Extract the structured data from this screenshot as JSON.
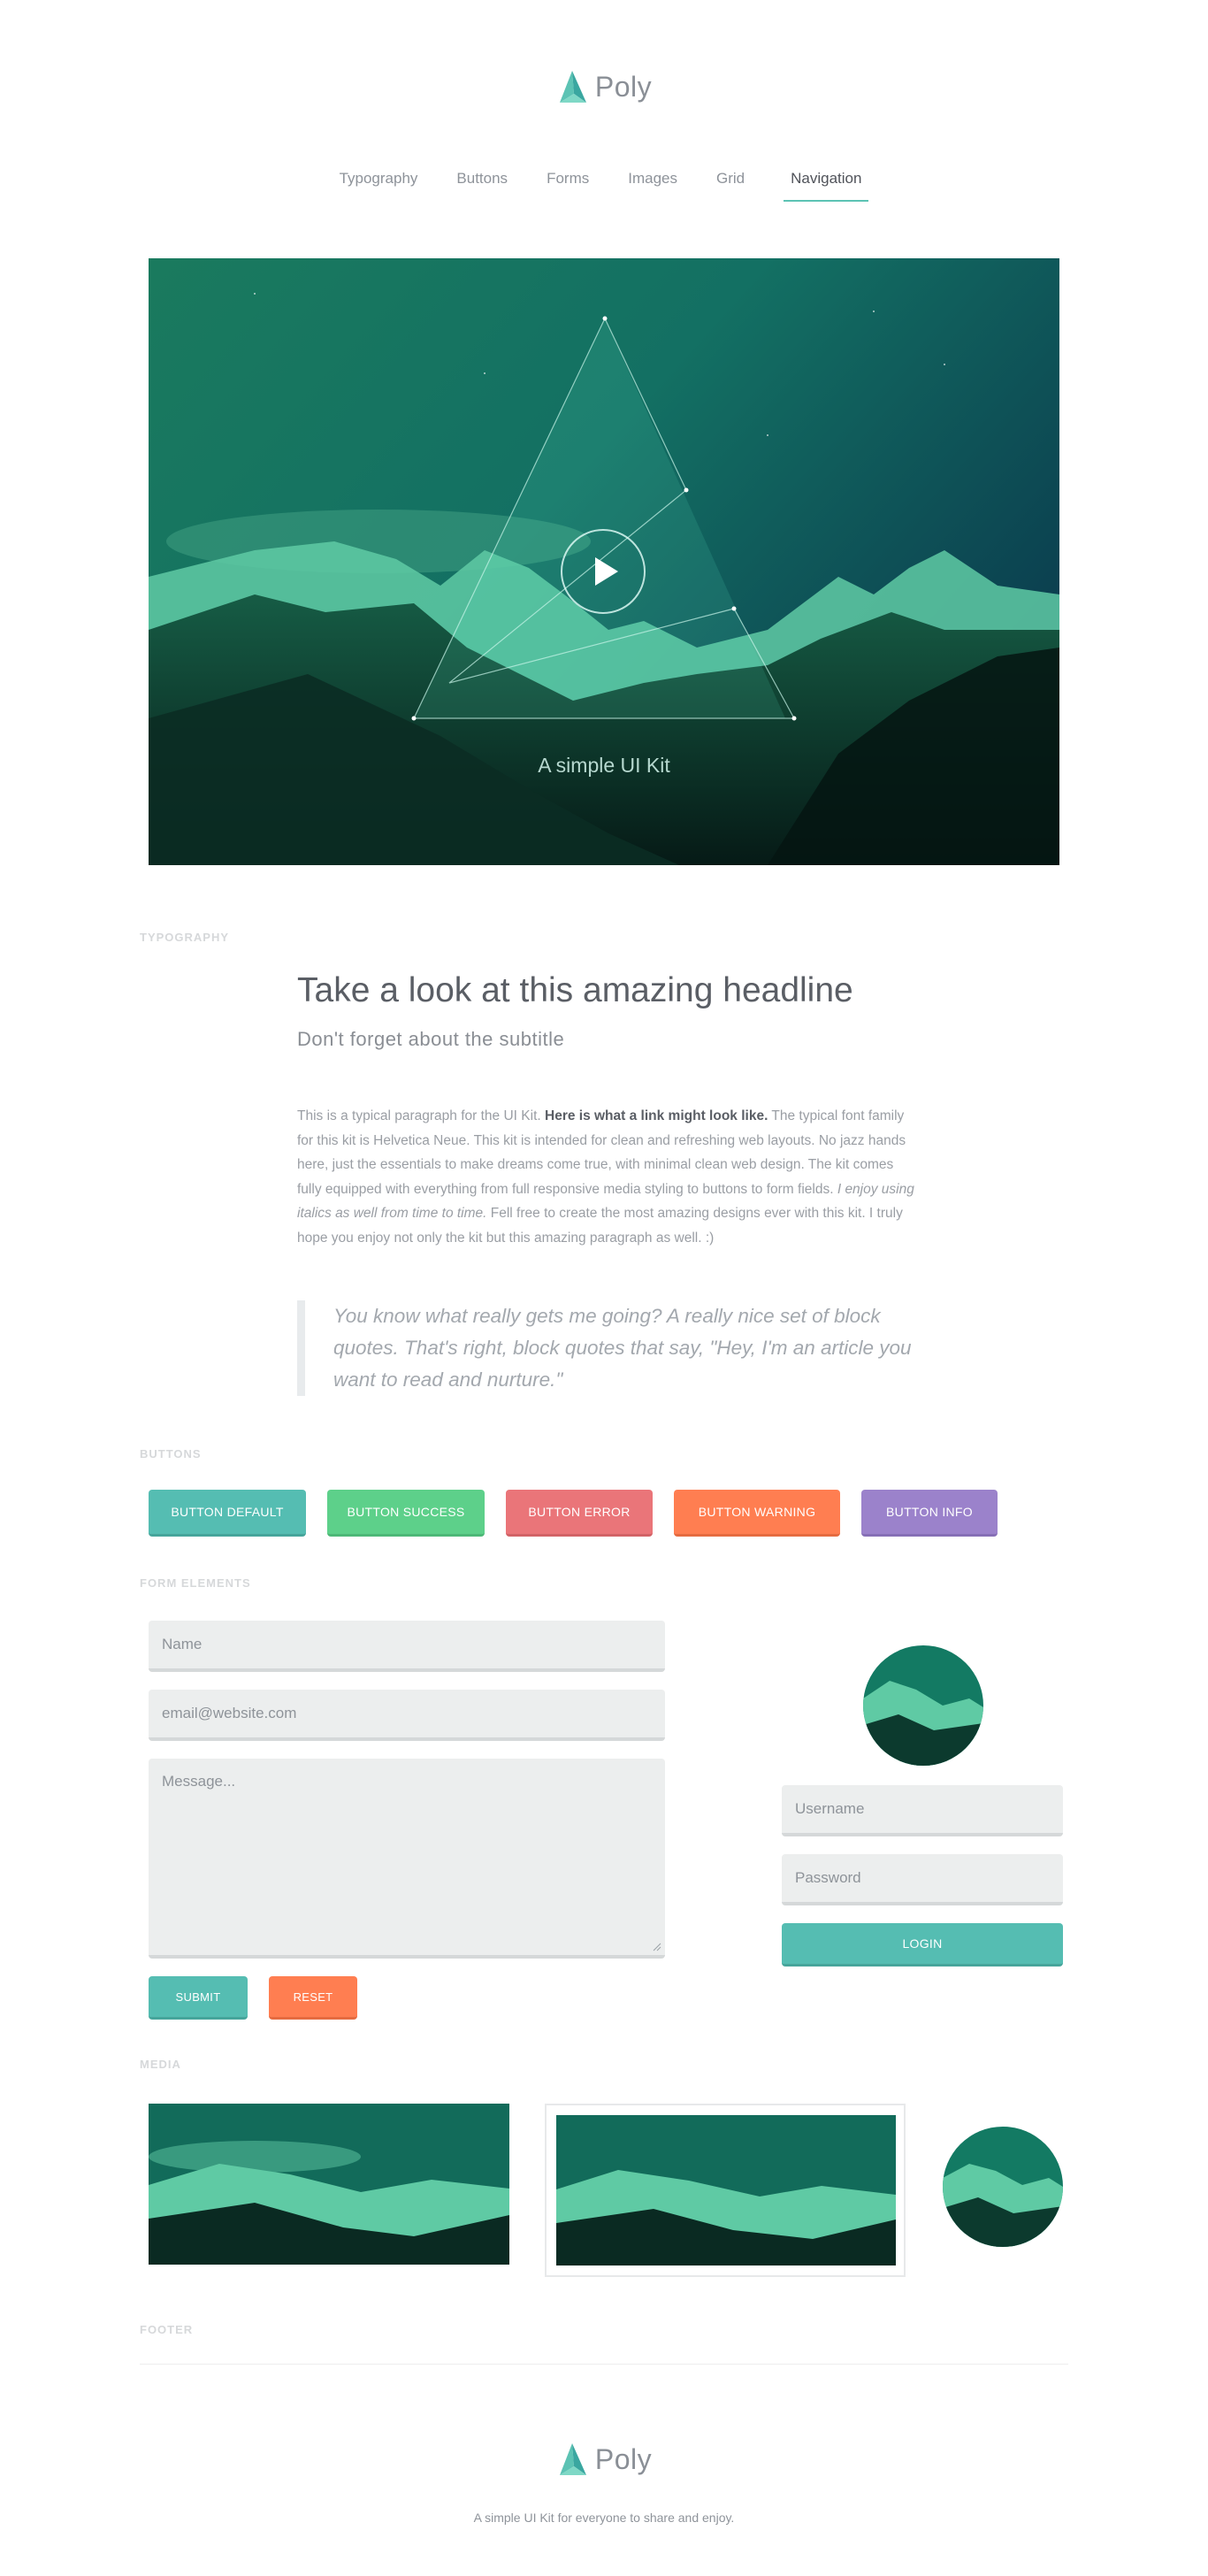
{
  "brand": {
    "name": "Poly",
    "accent": "#5cc3b4"
  },
  "nav": {
    "items": [
      "Typography",
      "Buttons",
      "Forms",
      "Images",
      "Grid",
      "Navigation"
    ],
    "active": "Navigation"
  },
  "hero": {
    "caption": "A simple UI Kit",
    "play_icon": "play-icon"
  },
  "sections": {
    "typography": "TYPOGRAPHY",
    "buttons": "BUTTONS",
    "forms": "FORM ELEMENTS",
    "media": "MEDIA",
    "footer": "FOOTER"
  },
  "typography": {
    "headline": "Take a look at this amazing headline",
    "subtitle": "Don't forget about the subtitle",
    "para_1": "This is a typical paragraph for the UI Kit.",
    "para_link": "Here is what a link might look like.",
    "para_2": " The typical font family for this kit is Helvetica Neue. This kit is intended for clean and refreshing web layouts. No jazz hands here, just the essentials to make dreams come true, with minimal clean web design. The kit comes fully equipped with everything from full responsive media styling to buttons to form fields. ",
    "para_em": "I enjoy using italics as well from time to time.",
    "para_3": " Fell free to create the most amazing designs ever with this kit. I truly hope you enjoy not only the kit but this amazing paragraph as well. :)",
    "blockquote": "You know what really gets me going? A really nice set of block quotes. That's right, block quotes that say, \"Hey, I'm an article you want to read and nurture.\""
  },
  "buttons": {
    "default": "BUTTON DEFAULT",
    "success": "BUTTON SUCCESS",
    "error": "BUTTON ERROR",
    "warning": "BUTTON WARNING",
    "info": "BUTTON INFO",
    "colors": {
      "default": "#55bdb2",
      "success": "#5dd08a",
      "error": "#ea7579",
      "warning": "#ff7e51",
      "info": "#9b82cb"
    }
  },
  "form": {
    "name_placeholder": "Name",
    "email_placeholder": "email@website.com",
    "message_placeholder": "Message...",
    "submit": "SUBMIT",
    "reset": "RESET",
    "username_placeholder": "Username",
    "password_placeholder": "Password",
    "login": "LOGIN"
  },
  "footer": {
    "tagline": "A simple UI Kit for everyone to share and enjoy."
  }
}
